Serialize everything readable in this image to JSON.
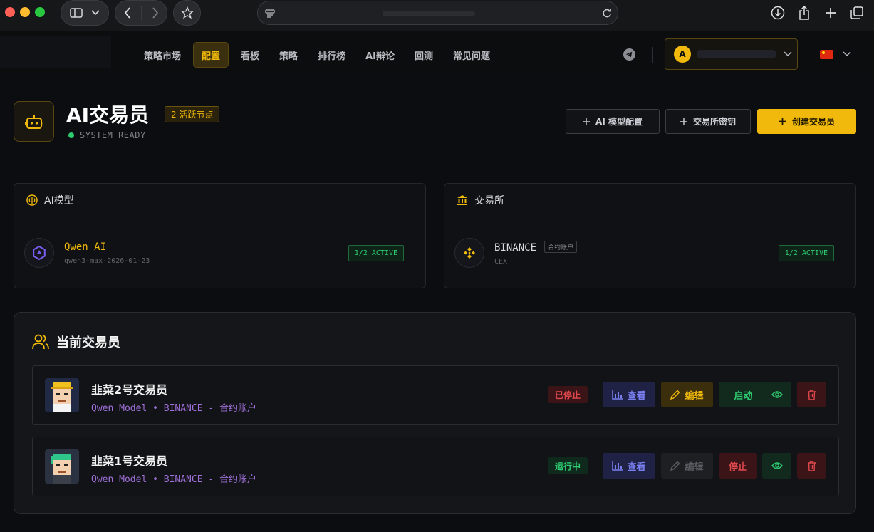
{
  "nav": {
    "items": [
      {
        "label": "策略市场",
        "active": false
      },
      {
        "label": "配置",
        "active": true
      },
      {
        "label": "看板",
        "active": false
      },
      {
        "label": "策略",
        "active": false
      },
      {
        "label": "排行榜",
        "active": false
      },
      {
        "label": "AI辩论",
        "active": false
      },
      {
        "label": "回测",
        "active": false
      },
      {
        "label": "常见问题",
        "active": false
      }
    ],
    "account_initial": "A"
  },
  "header": {
    "title": "AI交易员",
    "nodes_badge": "2 活跃节点",
    "status": "SYSTEM_READY",
    "btn_ai_model": "AI 模型配置",
    "btn_exchange_key": "交易所密钥",
    "btn_create": "创建交易员"
  },
  "ai_models_panel": {
    "title": "AI模型",
    "model_name": "Qwen AI",
    "model_id": "qwen3-max-2026-01-23",
    "active": "1/2 ACTIVE"
  },
  "exchange_panel": {
    "title": "交易所",
    "exchange_name": "BINANCE",
    "account_type": "合约账户",
    "category": "CEX",
    "active": "1/2 ACTIVE"
  },
  "traders": {
    "title": "当前交易员",
    "list": [
      {
        "name": "韭菜2号交易员",
        "subtitle": "Qwen Model • BINANCE - 合约账户",
        "status": "已停止",
        "view": "查看",
        "edit": "编辑",
        "toggle": "启动"
      },
      {
        "name": "韭菜1号交易员",
        "subtitle": "Qwen Model • BINANCE - 合约账户",
        "status": "运行中",
        "view": "查看",
        "edit": "编辑",
        "toggle": "停止"
      }
    ]
  },
  "colors": {
    "accent": "#f0b90b",
    "success": "#2ecc71",
    "danger": "#e0484e",
    "purple": "#a070d8"
  }
}
